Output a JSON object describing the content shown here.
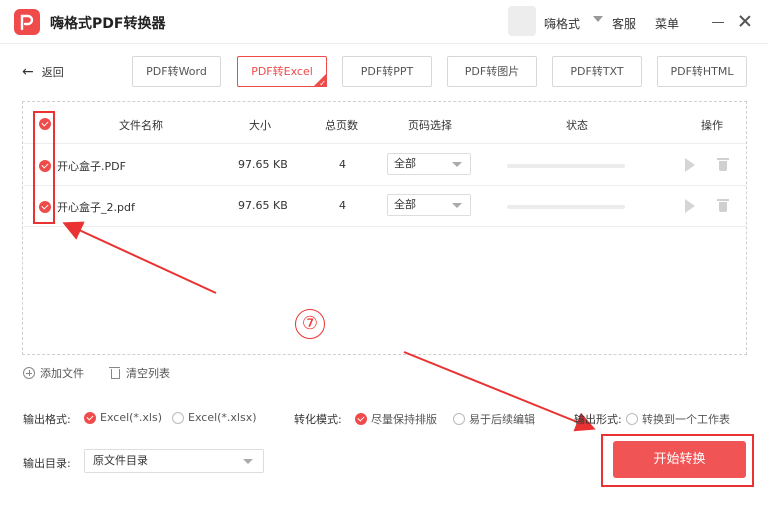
{
  "app": {
    "title": "嗨格式PDF转换器"
  },
  "user": {
    "name": "嗨格式",
    "service": "客服",
    "menu": "菜单"
  },
  "nav": {
    "back_label": "返回"
  },
  "tabs": [
    {
      "label": "PDF转Word",
      "active": false
    },
    {
      "label": "PDF转Excel",
      "active": true
    },
    {
      "label": "PDF转PPT",
      "active": false
    },
    {
      "label": "PDF转图片",
      "active": false
    },
    {
      "label": "PDF转TXT",
      "active": false
    },
    {
      "label": "PDF转HTML",
      "active": false
    }
  ],
  "table": {
    "headers": {
      "name": "文件名称",
      "size": "大小",
      "pages": "总页数",
      "page_select": "页码选择",
      "status": "状态",
      "actions": "操作"
    },
    "rows": [
      {
        "name": "开心盒子.PDF",
        "size": "97.65 KB",
        "pages": "4",
        "page_select": "全部",
        "progress": 0
      },
      {
        "name": "开心盒子_2.pdf",
        "size": "97.65 KB",
        "pages": "4",
        "page_select": "全部",
        "progress": 0
      }
    ]
  },
  "annotation": {
    "step": "⑦"
  },
  "toolbar": {
    "add_file": "添加文件",
    "clear_list": "清空列表"
  },
  "output_format": {
    "label": "输出格式:",
    "options": [
      "Excel(*.xls)",
      "Excel(*.xlsx)"
    ],
    "selected": 0
  },
  "convert_mode": {
    "label": "转化模式:",
    "options": [
      "尽量保持排版",
      "易于后续编辑"
    ],
    "selected": 0
  },
  "output_form": {
    "label": "输出形式:",
    "options": [
      "转换到一个工作表"
    ]
  },
  "output_dir": {
    "label": "输出目录:",
    "value": "原文件目录"
  },
  "actions": {
    "start_label": "开始转换"
  },
  "colors": {
    "accent": "#ef4b4b",
    "annotation": "#ea3232"
  }
}
